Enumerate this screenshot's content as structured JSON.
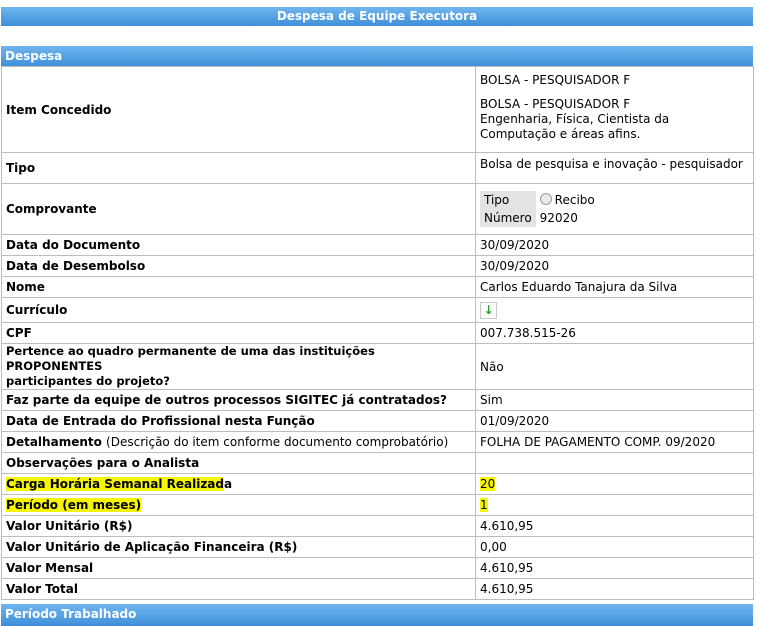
{
  "header": {
    "title": "Despesa de Equipe Executora"
  },
  "section": {
    "title": "Despesa"
  },
  "bottom": {
    "title": "Período Trabalhado"
  },
  "rows": {
    "item": {
      "label": "Item Concedido",
      "line1": "BOLSA - PESQUISADOR F",
      "line2": "BOLSA - PESQUISADOR F",
      "line3": "Engenharia, Física, Cientista da",
      "line4": "Computação e áreas afins."
    },
    "tipo": {
      "label": "Tipo",
      "value": "Bolsa de pesquisa e inovação - pesquisador"
    },
    "comprovante": {
      "label": "Comprovante",
      "tipo_label": "Tipo",
      "radio_label": "Recibo",
      "numero_label": "Número",
      "numero_value": "92020"
    },
    "data_doc": {
      "label": "Data do Documento",
      "value": "30/09/2020"
    },
    "data_des": {
      "label": "Data de Desembolso",
      "value": "30/09/2020"
    },
    "nome": {
      "label": "Nome",
      "value": "Carlos Eduardo Tanajura da Silva"
    },
    "curriculo": {
      "label": "Currículo",
      "icon": "download-arrow-icon"
    },
    "cpf": {
      "label": "CPF",
      "value": "007.738.515-26"
    },
    "quadro": {
      "label1": "Pertence ao quadro permanente de uma das instituições PROPONENTES",
      "label2": "participantes do projeto?",
      "value": "Não"
    },
    "equipe": {
      "label": "Faz parte da equipe de outros processos SIGITEC já contratados?",
      "value": "Sim"
    },
    "entrada": {
      "label": "Data de Entrada do Profissional nesta Função",
      "value": "01/09/2020"
    },
    "detalhamento": {
      "label": "Detalhamento",
      "label_note": "(Descrição do item conforme documento comprobatório)",
      "value": "FOLHA DE PAGAMENTO COMP. 09/2020"
    },
    "obs": {
      "label": "Observações para o Analista",
      "value": ""
    },
    "carga": {
      "label_hl": "Carga Horária Semanal Realizad",
      "label_rest": "a",
      "value": "20"
    },
    "periodo": {
      "label": "Período (em meses)",
      "value": "1"
    },
    "unitario": {
      "label": "Valor Unitário (R$)",
      "value": "4.610,95"
    },
    "aplicacao": {
      "label": "Valor Unitário de Aplicação Financeira (R$)",
      "value": "0,00"
    },
    "mensal": {
      "label": "Valor Mensal",
      "value": "4.610,95"
    },
    "total": {
      "label": "Valor Total",
      "value": "4.610,95"
    }
  }
}
